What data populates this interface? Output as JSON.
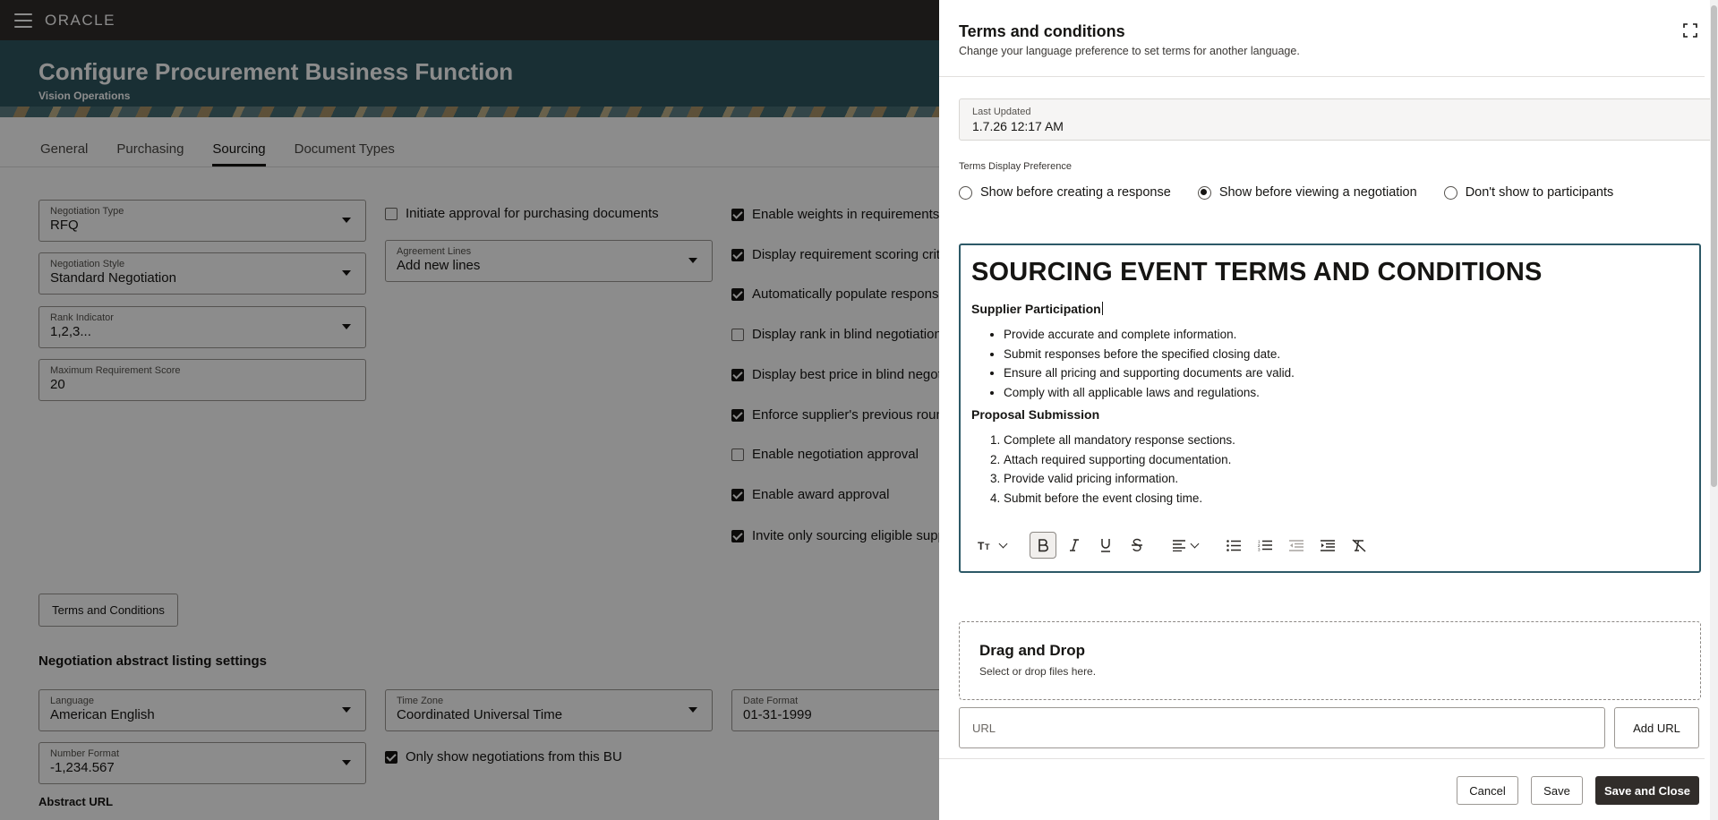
{
  "app": {
    "logo": "ORACLE",
    "page_title": "Configure Procurement Business Function",
    "page_subtitle": "Vision Operations",
    "tabs": [
      {
        "label": "General"
      },
      {
        "label": "Purchasing"
      },
      {
        "label": "Sourcing",
        "active": true
      },
      {
        "label": "Document Types"
      }
    ],
    "fields": {
      "negotiation_type": {
        "label": "Negotiation Type",
        "value": "RFQ"
      },
      "negotiation_style": {
        "label": "Negotiation Style",
        "value": "Standard Negotiation"
      },
      "rank_indicator": {
        "label": "Rank Indicator",
        "value": "1,2,3..."
      },
      "max_req_score": {
        "label": "Maximum Requirement Score",
        "value": "20"
      },
      "agreement_lines": {
        "label": "Agreement Lines",
        "value": "Add new lines"
      },
      "language": {
        "label": "Language",
        "value": "American English"
      },
      "time_zone": {
        "label": "Time Zone",
        "value": "Coordinated Universal Time"
      },
      "date_format": {
        "label": "Date Format",
        "value": "01-31-1999"
      },
      "number_format": {
        "label": "Number Format",
        "value": "-1,234.567"
      }
    },
    "checks": {
      "initiate_approval": {
        "label": "Initiate approval for purchasing documents",
        "checked": false
      },
      "enable_weights": {
        "label": "Enable weights in requirements",
        "checked": true
      },
      "display_req_scoring": {
        "label": "Display requirement scoring criteria",
        "checked": true
      },
      "auto_populate": {
        "label": "Automatically populate responses",
        "checked": true
      },
      "display_rank_blind": {
        "label": "Display rank in blind negotiations",
        "checked": false
      },
      "display_best_price": {
        "label": "Display best price in blind negotiations",
        "checked": true
      },
      "enforce_supplier": {
        "label": "Enforce supplier's previous round",
        "checked": true
      },
      "enable_neg_approval": {
        "label": "Enable negotiation approval",
        "checked": false
      },
      "enable_award_approval": {
        "label": "Enable award approval",
        "checked": true
      },
      "invite_only": {
        "label": "Invite only sourcing eligible suppliers",
        "checked": true
      },
      "only_show_bu": {
        "label": "Only show negotiations from this BU",
        "checked": true
      }
    },
    "terms_button": "Terms and Conditions",
    "abstract_heading": "Negotiation abstract listing settings",
    "abstract_url_label": "Abstract URL"
  },
  "drawer": {
    "title": "Terms and conditions",
    "subtitle": "Change your language preference to set terms for another language.",
    "last_updated": {
      "label": "Last Updated",
      "value": "1.7.26 12:17 AM"
    },
    "pref_label": "Terms Display Preference",
    "radios": [
      {
        "label": "Show before creating a response",
        "selected": false
      },
      {
        "label": "Show before viewing a negotiation",
        "selected": true
      },
      {
        "label": "Don't show to participants",
        "selected": false
      }
    ],
    "editor": {
      "heading": "SOURCING EVENT TERMS AND CONDITIONS",
      "section1_title": "Supplier Participation",
      "section1_items": [
        "Provide accurate and complete information.",
        "Submit responses before the specified closing date.",
        "Ensure all pricing and supporting documents are valid.",
        "Comply with all applicable laws and regulations."
      ],
      "section2_title": "Proposal Submission",
      "section2_items": [
        "Complete all mandatory response sections.",
        "Attach required supporting documentation.",
        "Provide valid pricing information.",
        "Submit before the event closing time."
      ]
    },
    "dropzone": {
      "title": "Drag and Drop",
      "subtitle": "Select or drop files here."
    },
    "url_placeholder": "URL",
    "add_url": "Add URL",
    "buttons": {
      "cancel": "Cancel",
      "save": "Save",
      "save_close": "Save and Close"
    }
  },
  "icons": {
    "menu": "hamburger-icon",
    "expand": "expand-icon",
    "text_size": "text-size-icon",
    "bold": "bold-icon",
    "italic": "italic-icon",
    "underline": "underline-icon",
    "strike": "strikethrough-icon",
    "align": "align-icon",
    "bullet_list": "bullet-list-icon",
    "numbered_list": "numbered-list-icon",
    "outdent": "outdent-icon",
    "indent": "indent-icon",
    "clear_format": "clear-format-icon"
  }
}
